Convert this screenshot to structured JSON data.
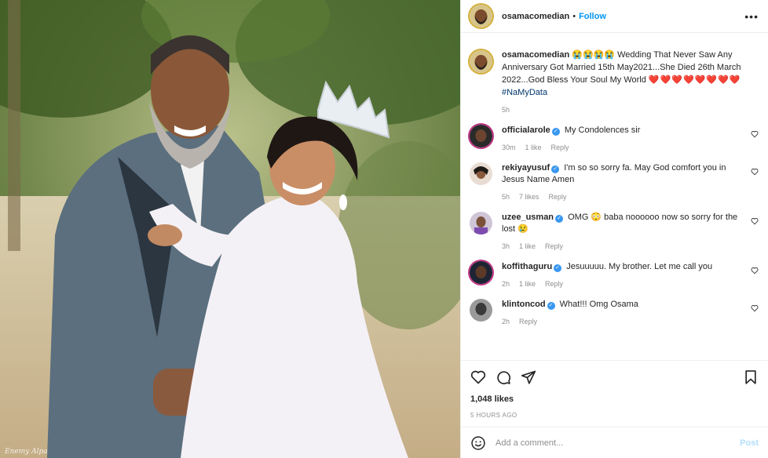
{
  "photo": {
    "watermark": "Enemy Alpa"
  },
  "header": {
    "username": "osamacomedian",
    "separator": "•",
    "follow_label": "Follow",
    "more_icon": "more-horizontal-icon"
  },
  "caption": {
    "username": "osamacomedian",
    "emojis": "😭😭😭😭",
    "text": "Wedding That Never Saw Any Anniversary Got Married 15th May2021...She Died 26th March 2022...God Bless Your Soul My World",
    "hearts": "❤️❤️❤️❤️❤️❤️❤️❤️",
    "hashtag": "#NaMyData",
    "age": "5h"
  },
  "comments": [
    {
      "username": "officialarole",
      "text": "My Condolences sir",
      "age": "30m",
      "likes": "1 like",
      "reply": "Reply"
    },
    {
      "username": "rekiyayusuf",
      "text": "I'm so so sorry fa. May God comfort you in Jesus Name Amen",
      "age": "5h",
      "likes": "7 likes",
      "reply": "Reply"
    },
    {
      "username": "uzee_usman",
      "text": "OMG 😳 baba noooooo now so sorry for the lost 😢",
      "age": "3h",
      "likes": "1 like",
      "reply": "Reply"
    },
    {
      "username": "koffithaguru",
      "text": "Jesuuuuu. My brother. Let me call you",
      "age": "2h",
      "likes": "1 like",
      "reply": "Reply"
    },
    {
      "username": "klintoncod",
      "text": "What!!! Omg Osama",
      "age": "2h",
      "likes": "",
      "reply": "Reply"
    }
  ],
  "likes": "1,048 likes",
  "timestamp": "5 HOURS AGO",
  "add_comment": {
    "placeholder": "Add a comment...",
    "post_label": "Post"
  },
  "colors": {
    "accent": "#0095f6",
    "heart": "#e0245e",
    "verified": "#3897f0"
  }
}
